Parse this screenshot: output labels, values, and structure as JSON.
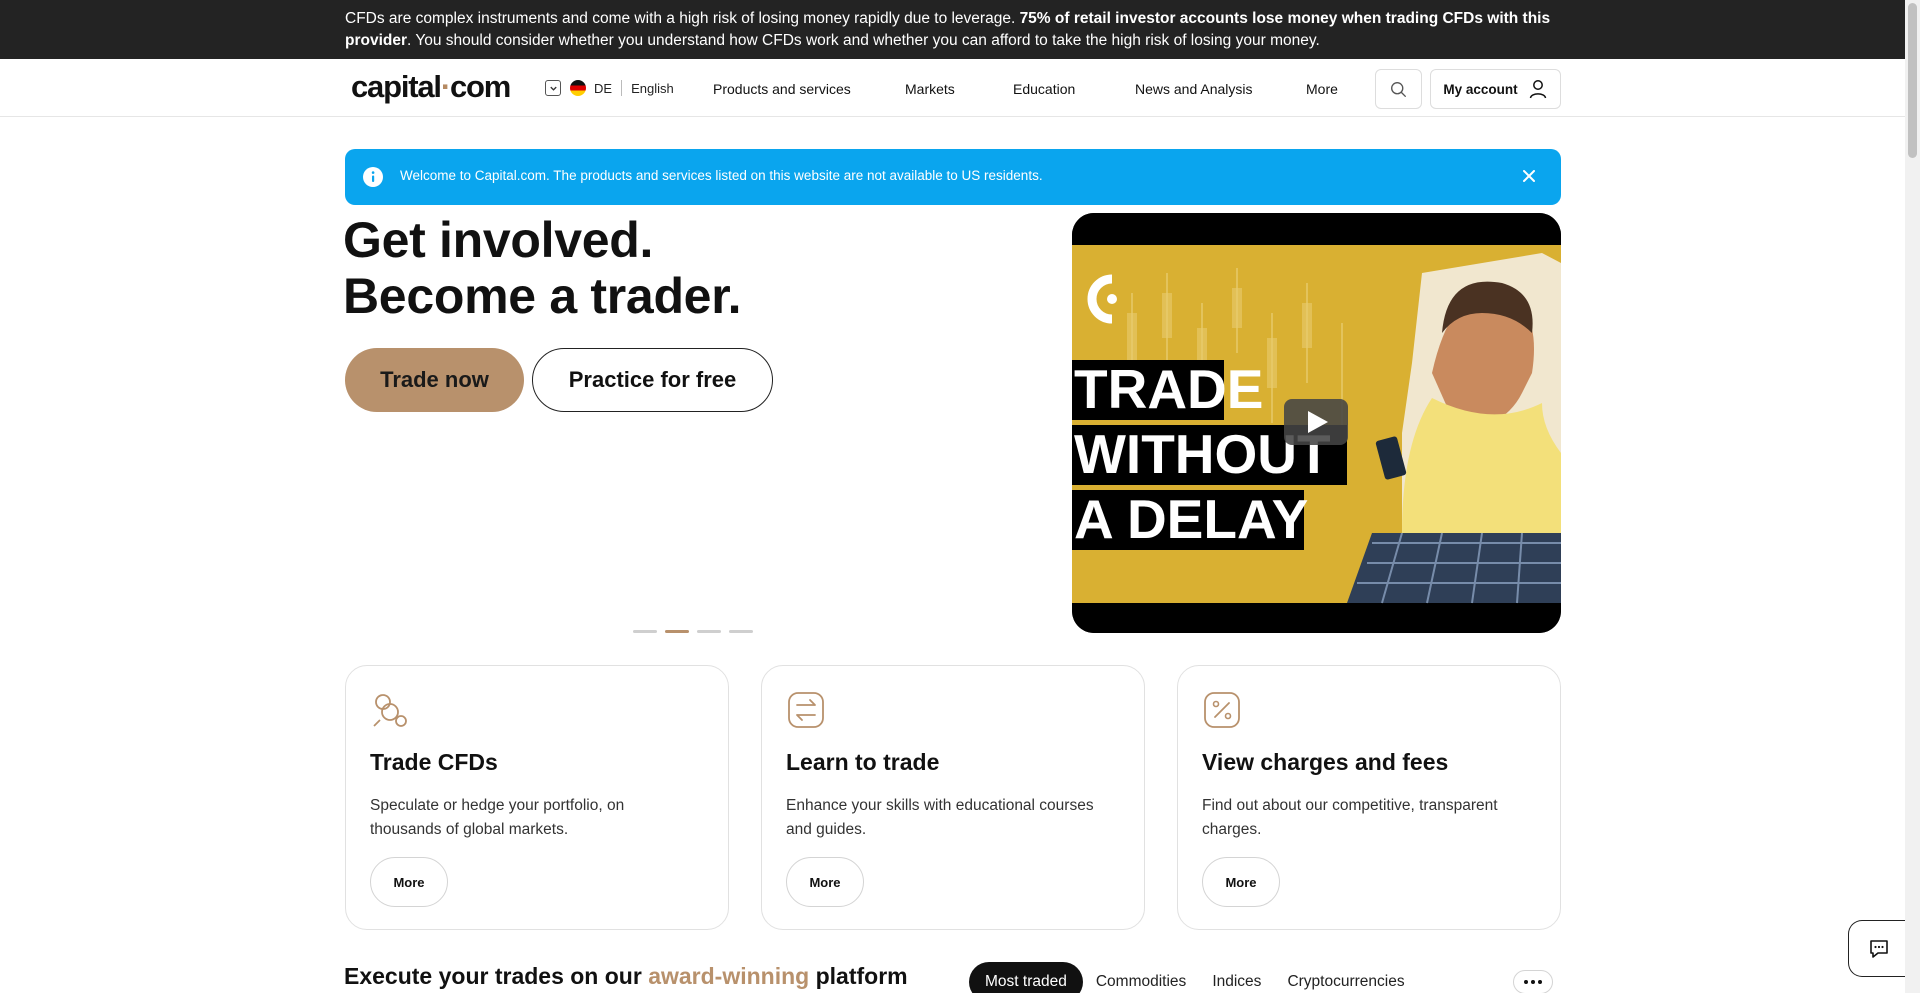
{
  "risk_warning": {
    "text_start": "CFDs are complex instruments and come with a high risk of losing money rapidly due to leverage. ",
    "text_bold": "75% of retail investor accounts lose money when trading CFDs with this provider",
    "text_end": ". You should consider whether you understand how CFDs work and whether you can afford to take the high risk of losing your money."
  },
  "header": {
    "logo_main": "capital",
    "logo_dot": "·",
    "logo_end": "com",
    "region_code": "DE",
    "language": "English",
    "nav": [
      "Products and services",
      "Markets",
      "Education",
      "News and Analysis",
      "More"
    ],
    "account_label": "My account"
  },
  "info_banner": {
    "text": "Welcome to Capital.com. The products and services listed on this website are not available to US residents."
  },
  "hero": {
    "title_line1": "Get involved.",
    "title_line2": "Become a trader.",
    "trade_button": "Trade now",
    "practice_button": "Practice for free",
    "slides_count": 4,
    "active_slide": 2,
    "video": {
      "line1": "TRADE",
      "line2": "WITHOUT",
      "line3": "A DELAY"
    }
  },
  "cards": [
    {
      "title": "Trade CFDs",
      "desc": "Speculate or hedge your portfolio, on thousands of global markets.",
      "more": "More",
      "icon": "coins-icon"
    },
    {
      "title": "Learn to trade",
      "desc": "Enhance your skills with educational courses and guides.",
      "more": "More",
      "icon": "exchange-icon"
    },
    {
      "title": "View charges and fees",
      "desc": "Find out about our competitive, transparent charges.",
      "more": "More",
      "icon": "percent-icon"
    }
  ],
  "platform_section": {
    "title_start": "Execute your trades on our ",
    "title_accent": "award-winning",
    "title_end": " platform",
    "tabs": [
      "Most traded",
      "Commodities",
      "Indices",
      "Cryptocurrencies"
    ],
    "active_tab": "Most traded"
  },
  "colors": {
    "accent": "#b8916c",
    "banner_blue": "#0aa5ee",
    "risk_bar": "#232323"
  }
}
